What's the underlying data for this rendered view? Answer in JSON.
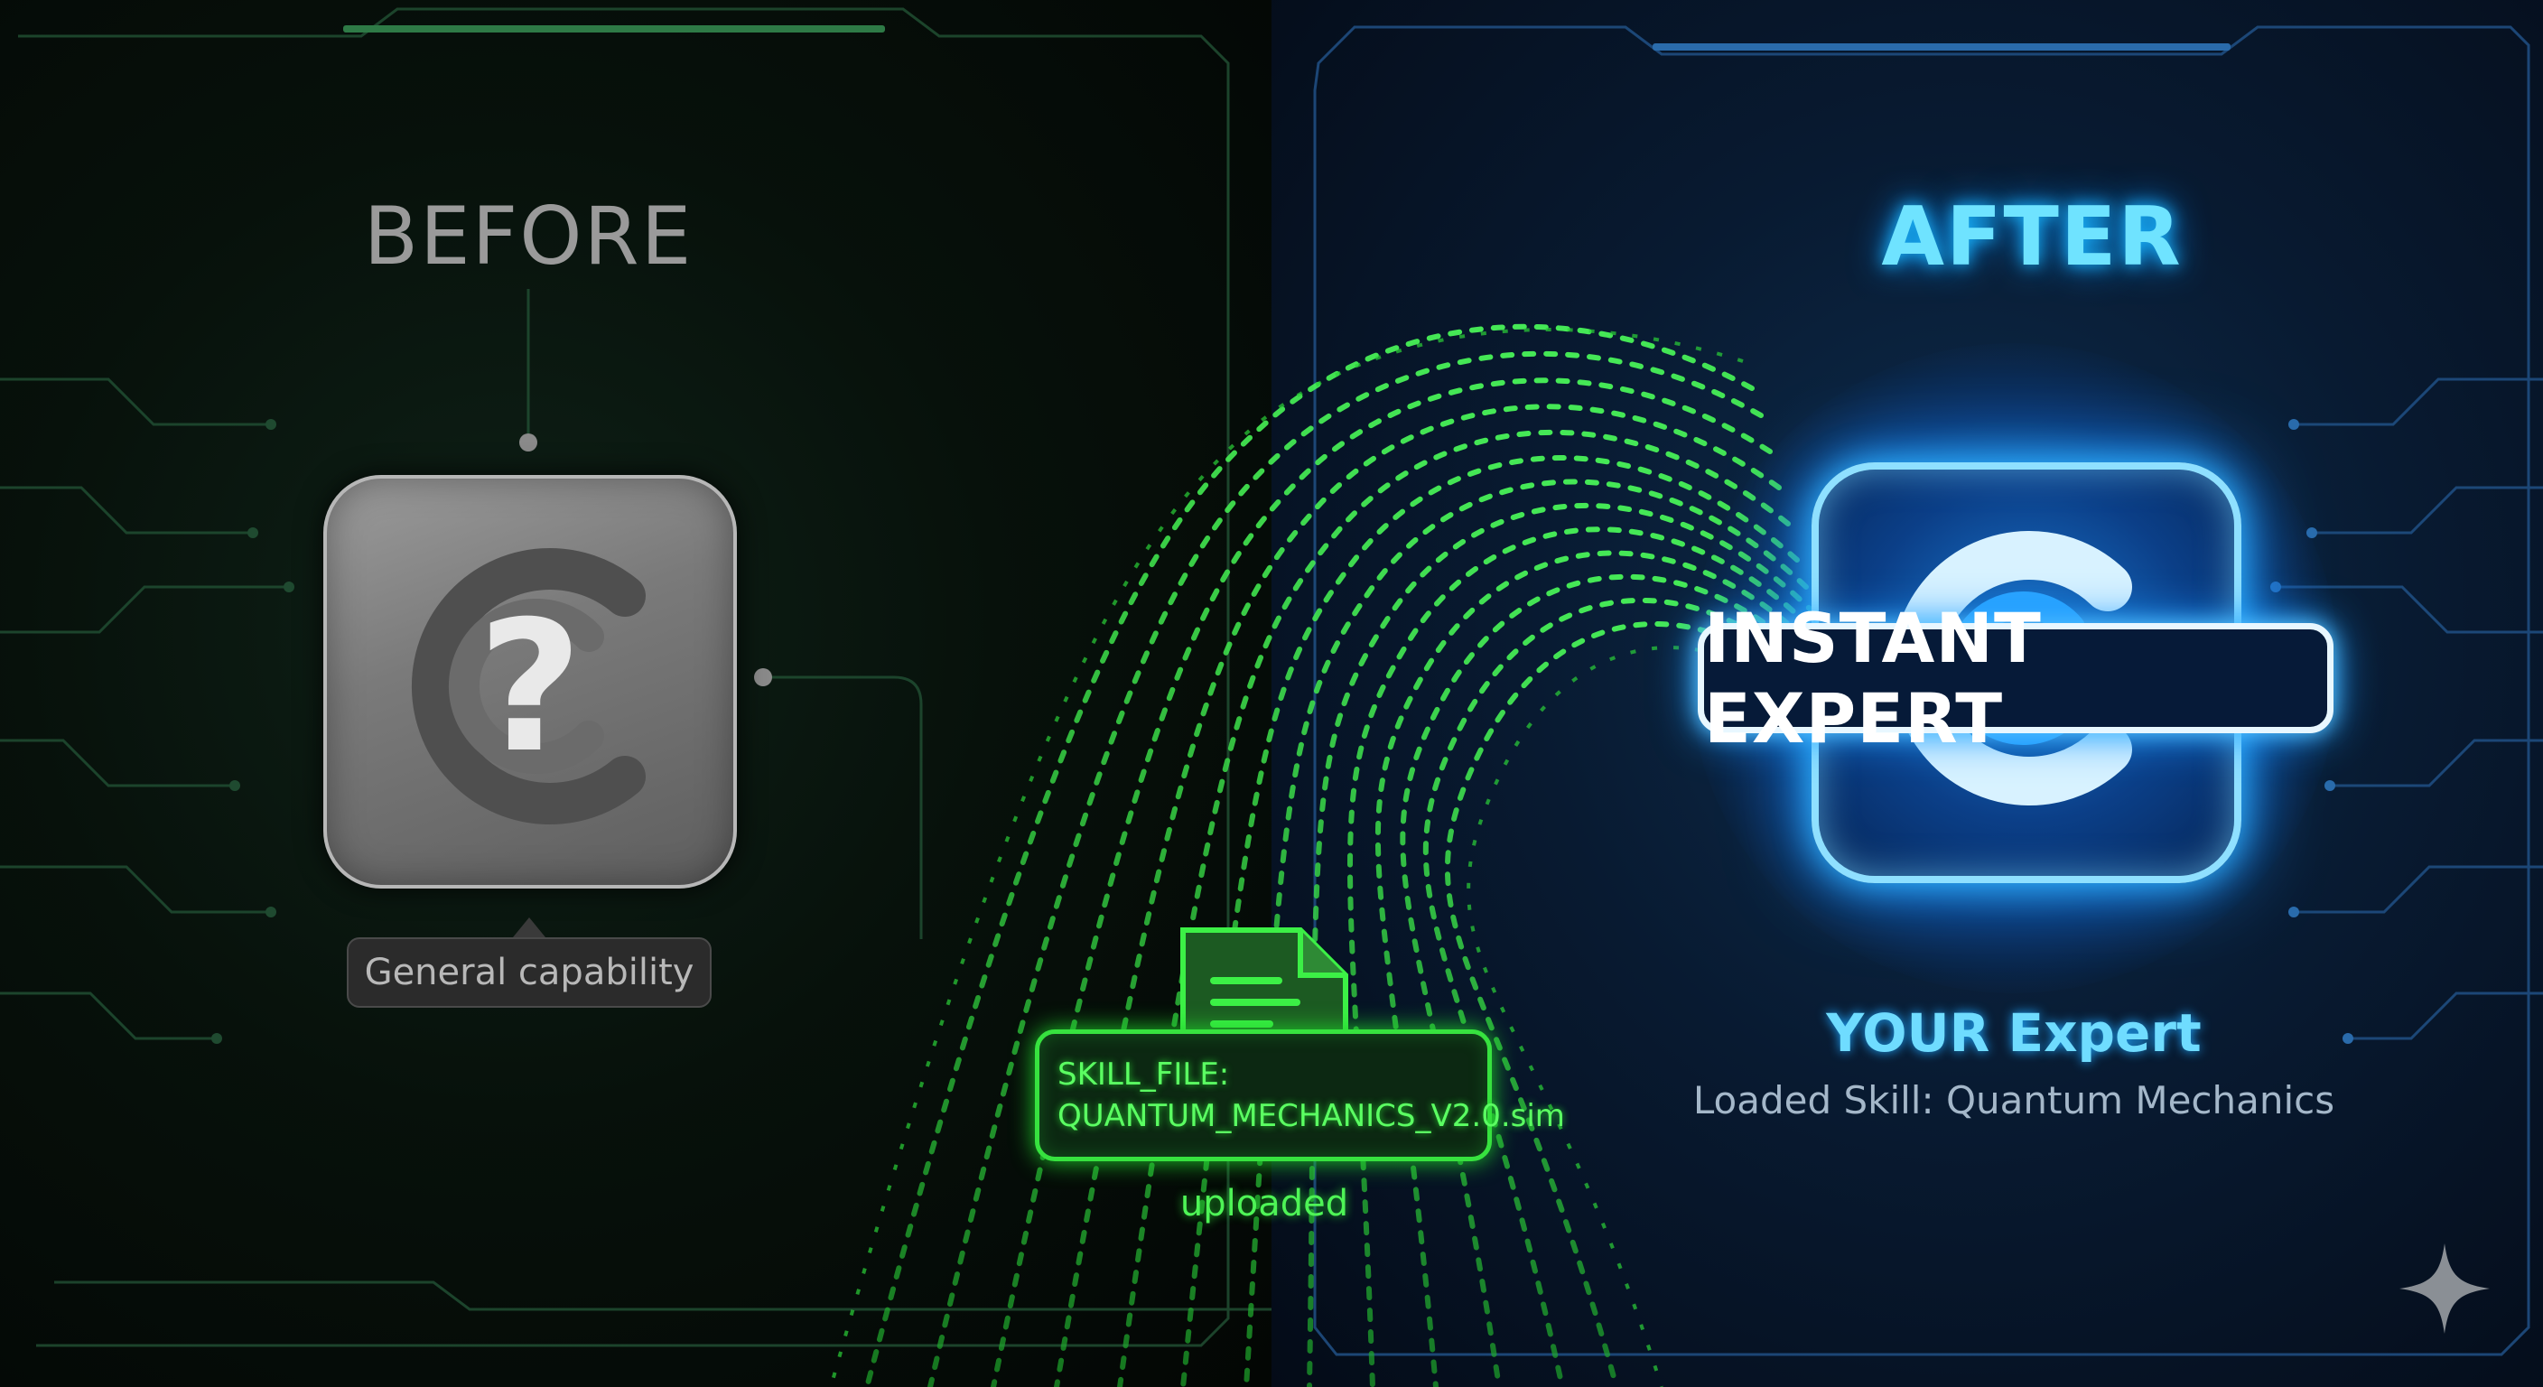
{
  "before": {
    "title": "BEFORE",
    "tile_icon": "question-mark-logo-icon",
    "label": "General capability"
  },
  "transfer": {
    "file_icon": "document-icon",
    "file_line1": "SKILL_FILE:",
    "file_line2": "QUANTUM_MECHANICS_V2.0.sim",
    "status": "uploaded"
  },
  "after": {
    "title": "AFTER",
    "badge": "INSTANT EXPERT",
    "heading": "YOUR Expert",
    "subheading": "Loaded Skill: Quantum Mechanics"
  },
  "corner_icon": "sparkle-icon",
  "colors": {
    "left_bg": "#07110b",
    "right_bg": "#081a31",
    "green_accent": "#37e23f",
    "blue_accent": "#6fe3ff",
    "grey_tile": "#7a7a7a"
  }
}
